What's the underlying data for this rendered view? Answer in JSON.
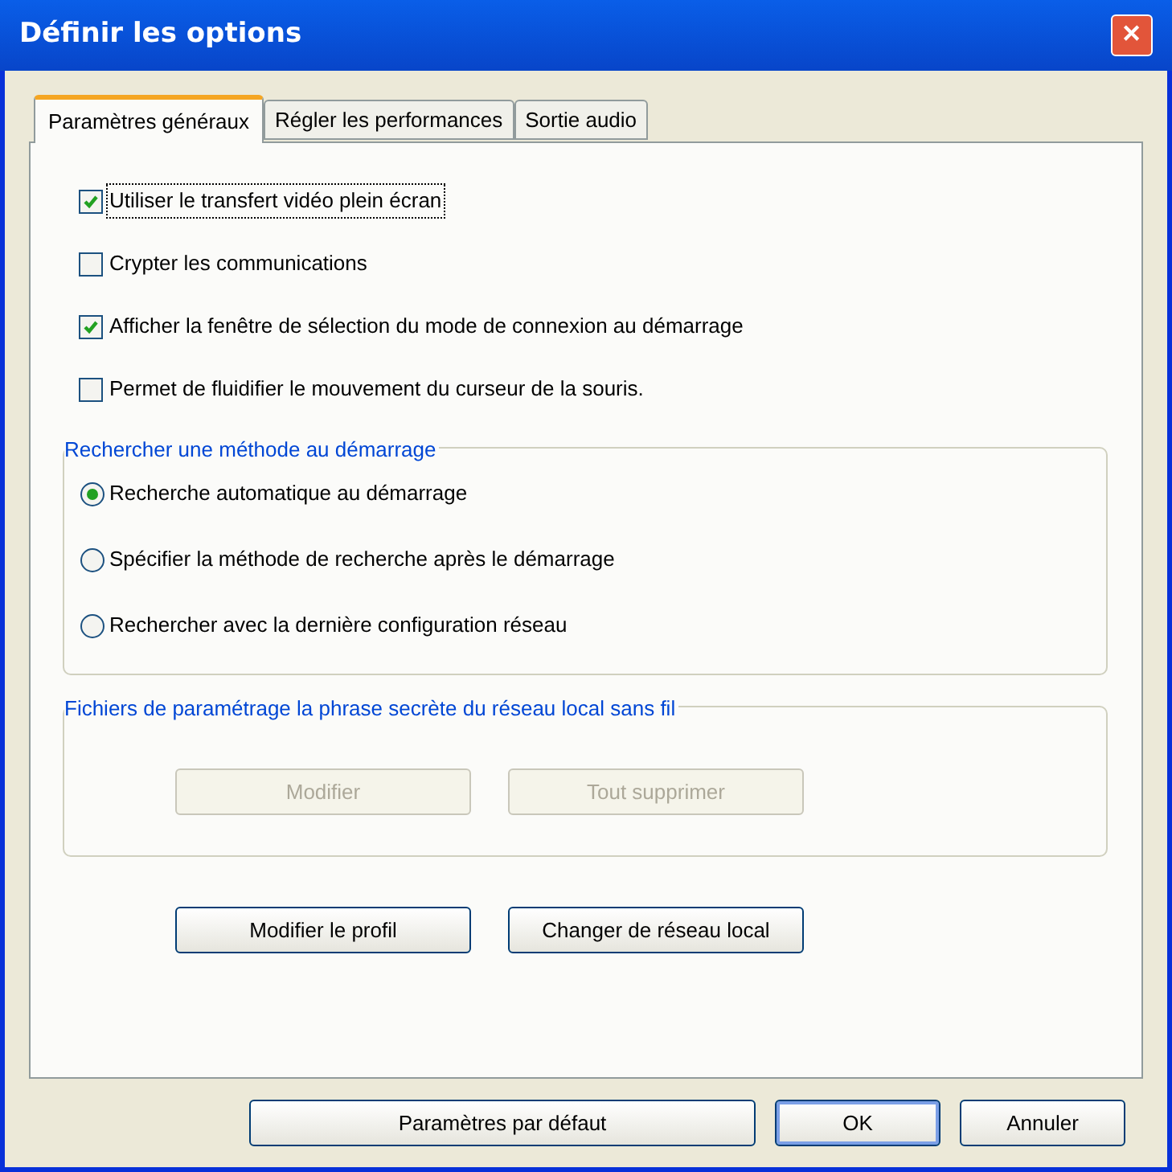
{
  "window": {
    "title": "Définir les options",
    "close_label": "✕"
  },
  "tabs": [
    {
      "label": "Paramètres généraux",
      "selected": true
    },
    {
      "label": "Régler les performances",
      "selected": false
    },
    {
      "label": "Sortie audio",
      "selected": false
    }
  ],
  "checkboxes": [
    {
      "label": "Utiliser le transfert vidéo plein écran",
      "checked": true,
      "focused": true
    },
    {
      "label": "Crypter les communications",
      "checked": false,
      "focused": false
    },
    {
      "label": "Afficher la fenêtre de sélection du mode de connexion au démarrage",
      "checked": true,
      "focused": false
    },
    {
      "label": "Permet de fluidifier le mouvement du curseur de la souris.",
      "checked": false,
      "focused": false
    }
  ],
  "startup_search": {
    "legend": "Rechercher une méthode au démarrage",
    "options": [
      {
        "label": "Recherche automatique au démarrage",
        "selected": true
      },
      {
        "label": "Spécifier la méthode de recherche après le démarrage",
        "selected": false
      },
      {
        "label": "Rechercher avec la dernière configuration réseau",
        "selected": false
      }
    ]
  },
  "wireless_passphrase": {
    "legend": "Fichiers de paramétrage la phrase secrète du réseau local sans fil",
    "buttons": [
      {
        "label": "Modifier",
        "disabled": true
      },
      {
        "label": "Tout supprimer",
        "disabled": true
      }
    ]
  },
  "profile_buttons": [
    {
      "label": "Modifier le profil",
      "disabled": false
    },
    {
      "label": "Changer de réseau local",
      "disabled": false
    }
  ],
  "footer_buttons": [
    {
      "label": "Paramètres par défaut",
      "default": false
    },
    {
      "label": "OK",
      "default": true
    },
    {
      "label": "Annuler",
      "default": false
    }
  ]
}
